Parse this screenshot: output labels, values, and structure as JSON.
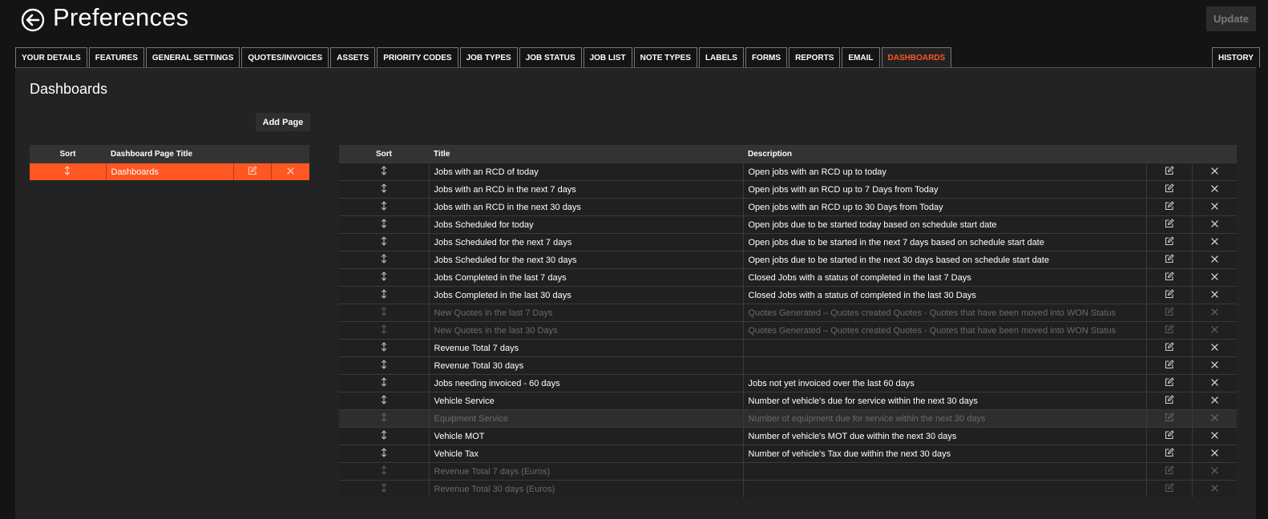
{
  "header": {
    "title": "Preferences",
    "update_label": "Update",
    "back_icon": "arrow-left-circle-icon"
  },
  "tabs": [
    {
      "label": "YOUR DETAILS"
    },
    {
      "label": "FEATURES"
    },
    {
      "label": "GENERAL SETTINGS"
    },
    {
      "label": "QUOTES/INVOICES"
    },
    {
      "label": "ASSETS"
    },
    {
      "label": "PRIORITY CODES"
    },
    {
      "label": "JOB TYPES"
    },
    {
      "label": "JOB STATUS"
    },
    {
      "label": "JOB LIST"
    },
    {
      "label": "NOTE TYPES"
    },
    {
      "label": "LABELS"
    },
    {
      "label": "FORMS"
    },
    {
      "label": "REPORTS"
    },
    {
      "label": "EMAIL"
    },
    {
      "label": "DASHBOARDS",
      "active": true
    }
  ],
  "history_tab": "HISTORY",
  "panel": {
    "title": "Dashboards",
    "add_page_label": "Add Page"
  },
  "pages_table": {
    "headers": {
      "sort": "Sort",
      "title": "Dashboard Page Title"
    },
    "rows": [
      {
        "title": "Dashboards",
        "selected": true
      }
    ]
  },
  "widgets_table": {
    "headers": {
      "sort": "Sort",
      "title": "Title",
      "description": "Description"
    },
    "rows": [
      {
        "title": "Jobs with an RCD of today",
        "description": "Open jobs with an RCD up to today",
        "enabled": true
      },
      {
        "title": "Jobs with an RCD in the next 7 days",
        "description": "Open jobs with an RCD up to 7 Days from Today",
        "enabled": true
      },
      {
        "title": "Jobs with an RCD in the next 30 days",
        "description": "Open jobs with an RCD up to 30 Days from Today",
        "enabled": true
      },
      {
        "title": "Jobs Scheduled for today",
        "description": "Open jobs due to be started today based on schedule start date",
        "enabled": true
      },
      {
        "title": "Jobs Scheduled for the next 7 days",
        "description": "Open jobs due to be started in the next 7 days based on schedule start date",
        "enabled": true
      },
      {
        "title": "Jobs Scheduled for the next 30 days",
        "description": "Open jobs due to be started in the next 30 days based on schedule start date",
        "enabled": true
      },
      {
        "title": "Jobs Completed in the last 7 days",
        "description": "Closed Jobs with a status of completed in the last 7 Days",
        "enabled": true
      },
      {
        "title": "Jobs Completed in the last 30 days",
        "description": "Closed Jobs with a status of completed in the last 30 Days",
        "enabled": true
      },
      {
        "title": "New Quotes in the last 7 Days",
        "description": "Quotes Generated – Quotes created Quotes - Quotes that have been moved into WON Status",
        "enabled": false
      },
      {
        "title": "New Quotes in the last 30 Days",
        "description": "Quotes Generated – Quotes created Quotes - Quotes that have been moved into WON Status",
        "enabled": false
      },
      {
        "title": "Revenue Total 7 days",
        "description": "",
        "enabled": true
      },
      {
        "title": "Revenue Total 30 days",
        "description": "",
        "enabled": true
      },
      {
        "title": "Jobs needing invoiced - 60 days",
        "description": "Jobs not yet invoiced over the last 60 days",
        "enabled": true
      },
      {
        "title": "Vehicle Service",
        "description": "Number of vehicle's due for service within the next 30 days",
        "enabled": true
      },
      {
        "title": "Equipment Service",
        "description": "Number of equipment due for service within the next 30 days",
        "enabled": false,
        "highlighted": true
      },
      {
        "title": "Vehicle MOT",
        "description": "Number of vehicle's MOT due within the next 30 days",
        "enabled": true
      },
      {
        "title": "Vehicle Tax",
        "description": "Number of vehicle's Tax due within the next 30 days",
        "enabled": true
      },
      {
        "title": "Revenue Total 7 days (Euros)",
        "description": "",
        "enabled": false
      },
      {
        "title": "Revenue Total 30 days (Euros)",
        "description": "",
        "enabled": false
      }
    ]
  },
  "icons": {
    "sort": "sort-arrows-icon",
    "edit": "edit-icon",
    "delete": "close-icon"
  },
  "colors": {
    "accent": "#ff5722",
    "background": "#141414",
    "panel": "#232323"
  }
}
